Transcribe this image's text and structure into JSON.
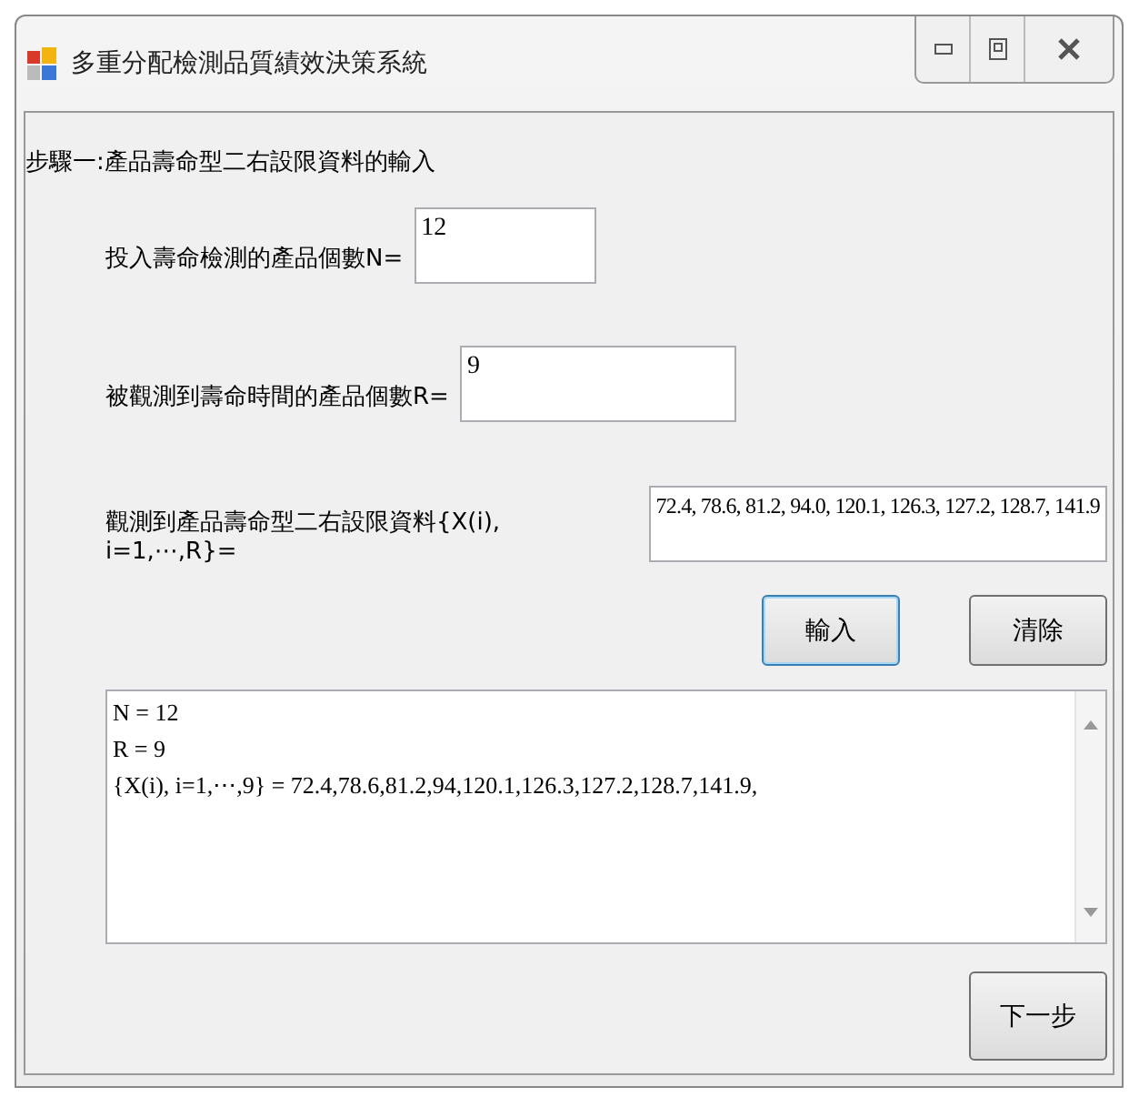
{
  "window": {
    "title": "多重分配檢測品質績效決策系統"
  },
  "step_title": "步驟一:產品壽命型二右設限資料的輸入",
  "fields": [
    {
      "label": "投入壽命檢測的產品個數N=",
      "value": "12"
    },
    {
      "label": "被觀測到壽命時間的產品個數R=",
      "value": "9"
    },
    {
      "label": "觀測到產品壽命型二右設限資料{X(i), i=1,⋯,R}=",
      "value": "72.4, 78.6, 81.2, 94.0, 120.1, 126.3, 127.2, 128.7, 141.9"
    }
  ],
  "buttons": [
    {
      "label": "輸入",
      "focused": true
    },
    {
      "label": "清除",
      "focused": false
    }
  ],
  "output": {
    "lines": [
      "N = 12",
      "R = 9",
      "{X(i), i=1,⋯,9} = 72.4,78.6,81.2,94,120.1,126.3,127.2,128.7,141.9,"
    ]
  },
  "next_button": {
    "label": "下一步"
  }
}
